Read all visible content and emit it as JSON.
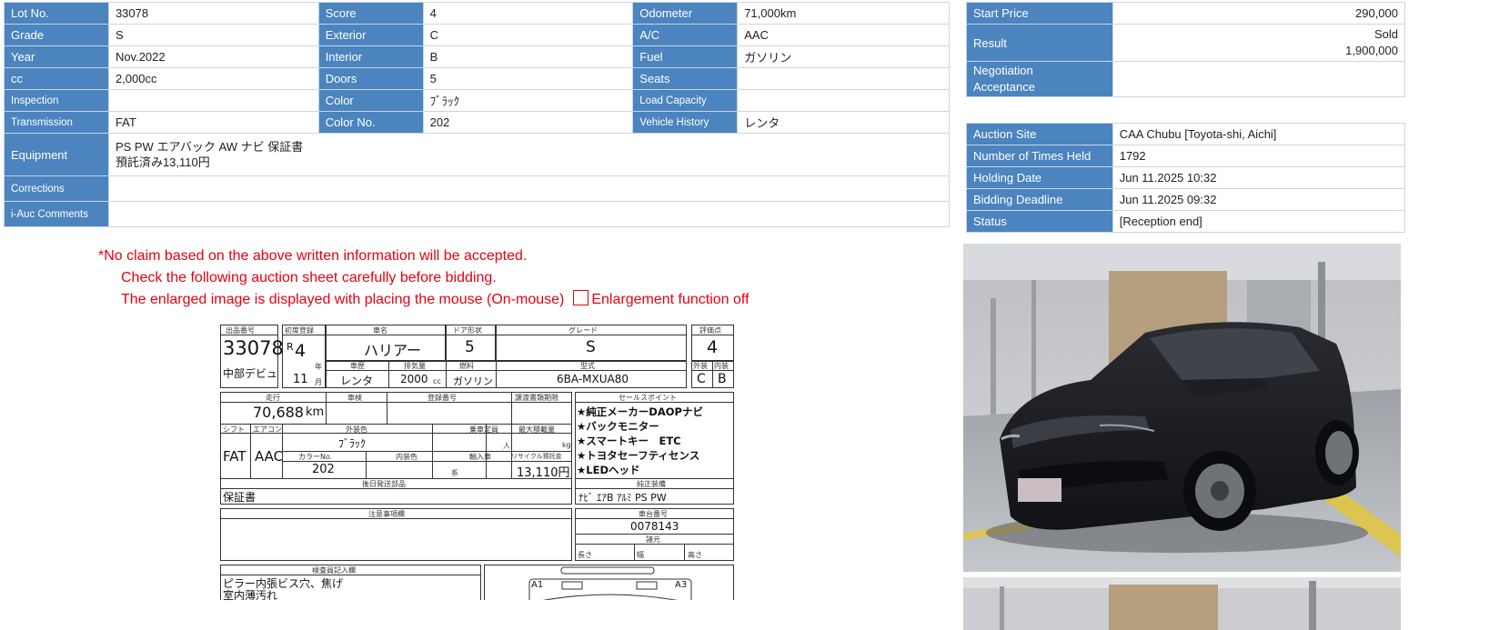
{
  "specs": {
    "lot_no": {
      "label": "Lot No.",
      "value": "33078"
    },
    "score": {
      "label": "Score",
      "value": "4"
    },
    "odometer": {
      "label": "Odometer",
      "value": "71,000km"
    },
    "grade": {
      "label": "Grade",
      "value": "S"
    },
    "exterior": {
      "label": "Exterior",
      "value": "C"
    },
    "ac": {
      "label": "A/C",
      "value": "AAC"
    },
    "year": {
      "label": "Year",
      "value": "Nov.2022"
    },
    "interior": {
      "label": "Interior",
      "value": "B"
    },
    "fuel": {
      "label": "Fuel",
      "value": "ガソリン"
    },
    "cc": {
      "label": "cc",
      "value": "2,000cc"
    },
    "doors": {
      "label": "Doors",
      "value": "5"
    },
    "seats": {
      "label": "Seats",
      "value": ""
    },
    "inspection": {
      "label": "Inspection",
      "value": ""
    },
    "color": {
      "label": "Color",
      "value": "ﾌﾞﾗｯｸ"
    },
    "load_capacity": {
      "label": "Load Capacity",
      "value": ""
    },
    "transmission": {
      "label": "Transmission",
      "value": "FAT"
    },
    "color_no": {
      "label": "Color No.",
      "value": "202"
    },
    "vehicle_history": {
      "label": "Vehicle History",
      "value": "レンタ"
    },
    "equipment": {
      "label": "Equipment",
      "line1": "PS PW エアバック AW ナビ 保証書",
      "line2": "預託済み13,110円"
    },
    "corrections": {
      "label": "Corrections",
      "value": ""
    },
    "iauc_comments": {
      "label": "i-Auc Comments",
      "value": ""
    }
  },
  "price": {
    "start_price": {
      "label": "Start Price",
      "value": "290,000"
    },
    "result": {
      "label": "Result",
      "status": "Sold",
      "value": "1,900,000"
    },
    "negotiation": {
      "label_line1": "Negotiation",
      "label_line2": "Acceptance",
      "value": ""
    }
  },
  "auction": {
    "site": {
      "label": "Auction Site",
      "value": "CAA Chubu [Toyota-shi, Aichi]"
    },
    "times_held": {
      "label": "Number of Times Held",
      "value": "1792"
    },
    "holding_date": {
      "label": "Holding Date",
      "value": "Jun 11.2025 10:32"
    },
    "bidding_deadline": {
      "label": "Bidding Deadline",
      "value": "Jun 11.2025 09:32"
    },
    "status": {
      "label": "Status",
      "value": "[Reception end]"
    }
  },
  "notice": {
    "line1": "*No claim based on the above written information will be accepted.",
    "line2": "Check the following auction sheet carefully before bidding.",
    "line3": "The enlarged image is displayed with placing the mouse (On-mouse)",
    "toggle_label": "Enlargement function off"
  },
  "sheet": {
    "h_lot": "出品番号",
    "h_first_reg": "初度登録",
    "h_name": "車名",
    "h_door": "ドア形状",
    "h_grade": "グレード",
    "h_score": "評価点",
    "lot": "33078",
    "era": "R",
    "era_year": "4",
    "nen": "年",
    "month": "11",
    "tsuki": "月",
    "name": "ハリアー",
    "door": "5",
    "grade": "S",
    "score": "4",
    "venue": "中部デビュ",
    "h_history": "車歴",
    "h_disp": "排気量",
    "h_fuel": "燃料",
    "h_model": "型式",
    "h_ext": "外装",
    "h_int": "内装",
    "history": "レンタ",
    "disp": "2000",
    "cc_unit": "cc",
    "fuel": "ガソリン",
    "model": "6BA-MXUA80",
    "ext": "C",
    "int": "B",
    "h_mileage": "走行",
    "h_shaken": "車検",
    "h_reg_no": "登録番号",
    "h_transfer": "譲渡書類期限",
    "h_points": "セールスポイント",
    "mileage": "70,688",
    "km": "km",
    "h_shift": "シフト",
    "h_ac": "エアコン",
    "h_color": "外装色",
    "h_cap": "乗車定員",
    "h_load": "最大積載量",
    "shift": "FAT",
    "ac": "AAC",
    "color": "ﾌﾞﾗｯｸ",
    "person": "人",
    "kg": "kg",
    "h_color_no": "カラーNo.",
    "h_int_color": "内装色",
    "h_import": "輸入車",
    "h_recycle": "リサイクル預託金",
    "color_no": "202",
    "kei": "系",
    "recycle": "13,110円",
    "points": [
      "★純正メーカーDAOPナビ",
      "★バックモニター",
      "★スマートキー　ETC",
      "★トヨタセーフティセンス",
      "★LEDヘッド"
    ],
    "h_equip": "純正装備",
    "equip": "ﾅﾋﾞ ｴｱB ｱﾙﾐ PS PW",
    "h_later": "後日発送部品",
    "later": "保証書",
    "h_notes": "注意事項欄",
    "h_chassis": "車台番号",
    "chassis": "0078143",
    "h_dims": "諸元",
    "len": "長さ",
    "wid": "幅",
    "hgt": "高さ",
    "h_inspector": "検査員記入欄",
    "insp1": "ピラー内張ビス穴、焦げ",
    "insp2": "室内薄汚れ",
    "a1": "A1",
    "a3": "A3"
  }
}
